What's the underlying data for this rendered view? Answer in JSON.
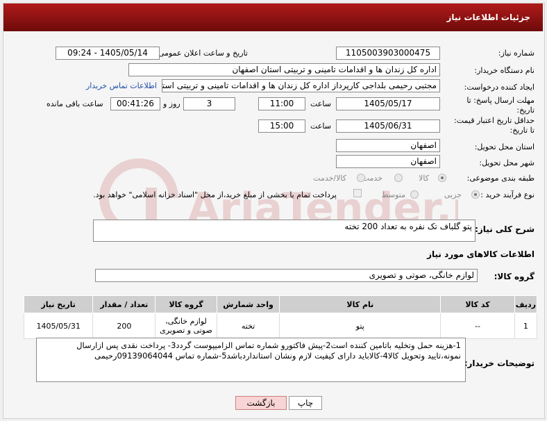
{
  "header": {
    "title": "جزئیات اطلاعات نیاز"
  },
  "fields": {
    "need_number": {
      "label": "شماره نیاز:",
      "value": "1105003903000475"
    },
    "announce": {
      "label": "تاریخ و ساعت اعلان عمومی:",
      "value": "1405/05/14 - 09:24"
    },
    "buyer": {
      "label": "نام دستگاه خریدار:",
      "value": "اداره کل زندان ها و اقدامات تامینی و تربیتی استان اصفهان"
    },
    "creator": {
      "label": "ایجاد کننده درخواست:",
      "value": "مجتبی رحیمی بلداجی کارپرداز اداره کل زندان ها و اقدامات تامینی و تربیتی استان اصفهان",
      "link": "اطلاعات تماس خریدار"
    },
    "deadline": {
      "label_line1": "مهلت ارسال پاسخ: تا",
      "label_line2": "تاریخ:",
      "date": "1405/05/17",
      "time_label": "ساعت",
      "time": "11:00",
      "days": "3",
      "days_label": "روز و",
      "remaining": "00:41:26",
      "remaining_label": "ساعت باقی مانده"
    },
    "validity": {
      "label_line1": "حداقل تاریخ اعتبار قیمت:",
      "label_line2": "تا تاریخ:",
      "date": "1405/06/31",
      "time_label": "ساعت",
      "time": "15:00"
    },
    "province": {
      "label": "استان محل تحویل:",
      "value": "اصفهان"
    },
    "city": {
      "label": "شهر محل تحویل:",
      "value": "اصفهان"
    },
    "category": {
      "label": "طبقه بندی موضوعی:",
      "options": [
        "کالا",
        "خدمت",
        "کالا/خدمت"
      ]
    },
    "process": {
      "label": "نوع فرآیند خرید :",
      "options": [
        "جزیی",
        "متوسط"
      ],
      "note": "پرداخت تمام یا بخشی از مبلغ خرید،از محل \"اسناد خزانه اسلامی\" خواهد بود."
    }
  },
  "description": {
    "label": "شرح کلی نیاز:",
    "value": "پتو گلباف تک نفره به تعداد 200 تخته"
  },
  "goods_section": {
    "title": "اطلاعات کالاهای مورد نیاز"
  },
  "goods_group": {
    "label": "گروه کالا:",
    "value": "لوازم خانگی، صوتی و تصویری"
  },
  "table": {
    "headers": [
      "ردیف",
      "کد کالا",
      "نام کالا",
      "واحد شمارش",
      "گروه کالا",
      "تعداد / مقدار",
      "تاریخ نیاز"
    ],
    "rows": [
      [
        "1",
        "--",
        "پتو",
        "تخته",
        "لوازم خانگی، صوتی و تصویری",
        "200",
        "1405/05/31"
      ]
    ]
  },
  "buyer_notes": {
    "label": "توضیحات خریدار:",
    "value": "1-هزینه حمل وتخلیه باتامین کننده است2-پیش فاکتورو شماره تماس الزامیپوست گردد3- پرداخت نقدی پس ازارسال نمونه،تایید وتحویل کالا4-کالاباید دارای کیفیت لازم ونشان استانداردباشد5-شماره تماس 09139064044رحیمی"
  },
  "buttons": {
    "print": "چاپ",
    "back": "بازگشت"
  },
  "watermark": {
    "text": "AriaTender.net"
  }
}
